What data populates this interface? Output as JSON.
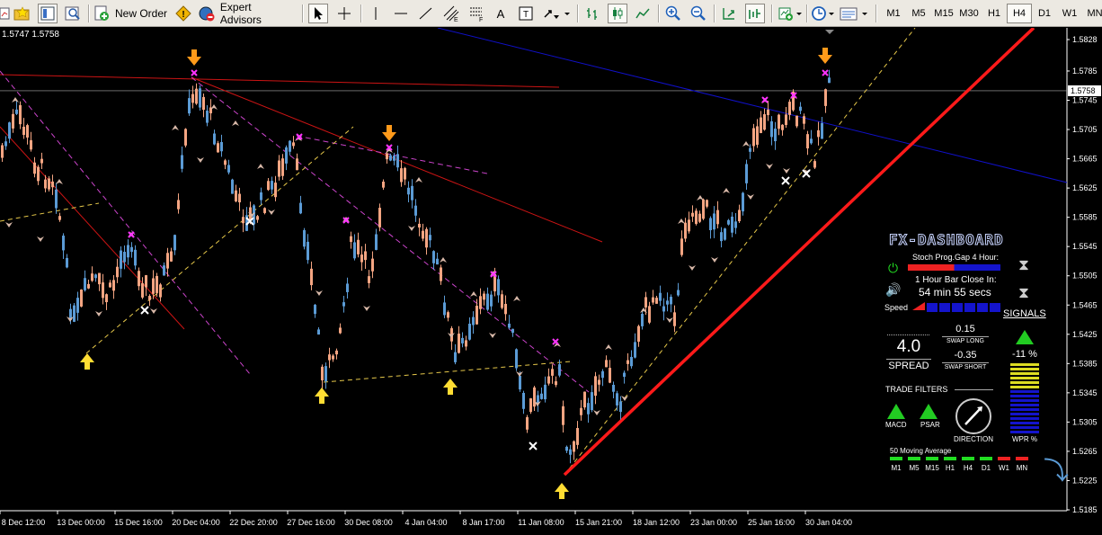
{
  "toolbar": {
    "new_order": "New Order",
    "expert_advisors": "Expert Advisors",
    "text_tool": "A",
    "timeframes": [
      {
        "label": "M1",
        "active": false
      },
      {
        "label": "M5",
        "active": false
      },
      {
        "label": "M15",
        "active": false
      },
      {
        "label": "M30",
        "active": false
      },
      {
        "label": "H1",
        "active": false
      },
      {
        "label": "H4",
        "active": true
      },
      {
        "label": "D1",
        "active": false
      },
      {
        "label": "W1",
        "active": false
      },
      {
        "label": "MN",
        "active": false
      }
    ]
  },
  "chart": {
    "price_readout": "1.5747 1.5758",
    "current_price": "1.5758",
    "price_ticks": [
      "1.5828",
      "1.5785",
      "1.5745",
      "1.5705",
      "1.5665",
      "1.5625",
      "1.5585",
      "1.5545",
      "1.5505",
      "1.5465",
      "1.5425",
      "1.5385",
      "1.5345",
      "1.5305",
      "1.5265",
      "1.5225",
      "1.5185"
    ],
    "time_ticks": [
      "8 Dec 12:00",
      "13 Dec 00:00",
      "15 Dec 16:00",
      "20 Dec 04:00",
      "22 Dec 20:00",
      "27 Dec 16:00",
      "30 Dec 08:00",
      "4 Jan 04:00",
      "8 Jan 17:00",
      "11 Jan 08:00",
      "15 Jan 21:00",
      "18 Jan 12:00",
      "23 Jan 00:00",
      "25 Jan 16:00",
      "30 Jan 04:00"
    ],
    "colors": {
      "bull": "#5b9bd5",
      "bear": "#f4a582",
      "support_line": "#ff0000",
      "resistance_blue": "#1010c8",
      "trend_dashed": "#cc44cc",
      "fib_yellow": "#e6c84a"
    }
  },
  "dashboard": {
    "title": "FX-DASHBOARD",
    "stoch_label": "Stoch Prog.Gap 4 Hour:",
    "bar_close_label": "1 Hour Bar Close In:",
    "bar_close_value": "54 min 55 secs",
    "speed_label": "Speed",
    "signals_label": "SIGNALS",
    "spread_value": "4.0",
    "spread_label": "SPREAD",
    "swap_long_value": "0.15",
    "swap_long_label": "SWAP LONG",
    "swap_short_value": "-0.35",
    "swap_short_label": "SWAP SHORT",
    "wpr_value": "-11 %",
    "wpr_label": "WPR %",
    "trade_filters_label": "TRADE FILTERS",
    "macd_label": "MACD",
    "psar_label": "PSAR",
    "direction_label": "DIRECTION",
    "ma_label": "50 Moving Average",
    "ma_timeframes": [
      {
        "label": "M1",
        "color": "#22dd22"
      },
      {
        "label": "M5",
        "color": "#22dd22"
      },
      {
        "label": "M15",
        "color": "#22dd22"
      },
      {
        "label": "H1",
        "color": "#22dd22"
      },
      {
        "label": "H4",
        "color": "#22dd22"
      },
      {
        "label": "D1",
        "color": "#22dd22"
      },
      {
        "label": "W1",
        "color": "#ee2222"
      },
      {
        "label": "MN",
        "color": "#ee2222"
      }
    ]
  }
}
